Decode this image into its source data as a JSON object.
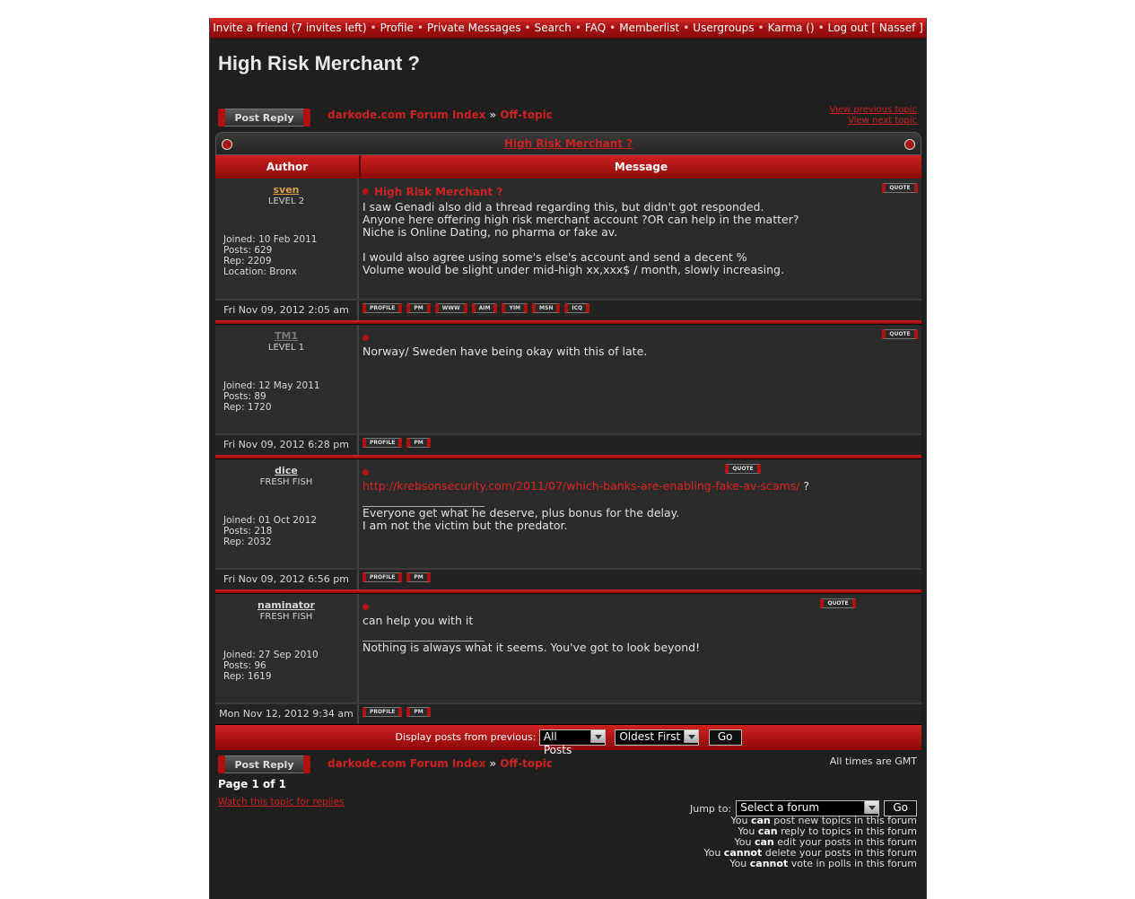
{
  "nav": {
    "items": [
      "Invite a friend (7 invites left)",
      "Profile",
      "Private Messages",
      "Search",
      "FAQ",
      "Memberlist",
      "Usergroups",
      "Karma ()",
      "Log out [ Nassef ]"
    ]
  },
  "page_title": "High Risk Merchant ?",
  "post_reply_label": "Post Reply",
  "breadcrumb": {
    "forum_index": "darkode.com Forum Index",
    "separator": "»",
    "forum": "Off-topic"
  },
  "topic_nav": {
    "previous": "View previous topic",
    "next": "View next topic"
  },
  "table": {
    "title": "High Risk Merchant ?",
    "col_author": "Author",
    "col_message": "Message"
  },
  "posts": [
    {
      "author": "sven",
      "author_color": "#d8a04a",
      "rank": "LEVEL 2",
      "info": [
        "Joined: 10 Feb 2011",
        "Posts: 629",
        "Rep: 2209",
        "Location: Bronx"
      ],
      "subject": "High Risk Merchant ?",
      "body": "I saw Genadi also did a thread regarding this, but didn't got responded.\nAnyone here offering high risk merchant account ?OR can help in the matter?\nNiche is Online Dating, no pharma or fake av.\n\nI would also agree using some's else's account and send a decent %\nVolume would be slight under mid-high xx,xxx$ / month, slowly increasing.",
      "date": "Fri Nov 09, 2012 2:05 am",
      "buttons": [
        "PROFILE",
        "PM",
        "WWW",
        "AIM",
        "YIM",
        "MSN",
        "ICQ"
      ],
      "quote": "QUOTE"
    },
    {
      "author": "TM1",
      "author_color": "#777777",
      "rank": "LEVEL 1",
      "info": [
        "Joined: 12 May 2011",
        "Posts: 89",
        "Rep: 1720"
      ],
      "subject": "",
      "body": "Norway/ Sweden have being okay with this of late.",
      "date": "Fri Nov 09, 2012 6:28 pm",
      "buttons": [
        "PROFILE",
        "PM"
      ],
      "quote": "QUOTE"
    },
    {
      "author": "dice",
      "author_color": "#d8d8d8",
      "rank": "FRESH FISH",
      "info": [
        "Joined: 01 Oct 2012",
        "Posts: 218",
        "Rep: 2032"
      ],
      "subject": "",
      "link": "http://krebsonsecurity.com/2011/07/which-banks-are-enabling-fake-av-scams/",
      "link_suffix": " ?",
      "signature": "Everyone get what he deserve, plus bonus for the delay.\nI am not the victim but the predator.",
      "date": "Fri Nov 09, 2012 6:56 pm",
      "buttons": [
        "PROFILE",
        "PM"
      ],
      "quote": "QUOTE"
    },
    {
      "author": "naminator",
      "author_color": "#d8d8d8",
      "rank": "FRESH FISH",
      "info": [
        "Joined: 27 Sep 2010",
        "Posts: 96",
        "Rep: 1619"
      ],
      "subject": "",
      "body": "can help you with it",
      "signature": "Nothing is always what it seems. You've got to look beyond!",
      "date": "Mon Nov 12, 2012 9:34 am",
      "buttons": [
        "PROFILE",
        "PM"
      ],
      "quote": "QUOTE"
    }
  ],
  "display": {
    "label": "Display posts from previous:",
    "posts_select": "All Posts",
    "order_select": "Oldest First",
    "go": "Go"
  },
  "timezone": "All times are GMT",
  "page_info": "Page 1 of 1",
  "watch_topic": "Watch this topic for replies",
  "jump": {
    "label": "Jump to:",
    "select": "Select a forum",
    "go": "Go"
  },
  "permissions": [
    [
      "You ",
      "can",
      " post new topics in this forum"
    ],
    [
      "You ",
      "can",
      " reply to topics in this forum"
    ],
    [
      "You ",
      "can",
      " edit your posts in this forum"
    ],
    [
      "You ",
      "cannot",
      " delete your posts in this forum"
    ],
    [
      "You ",
      "cannot",
      " vote in polls in this forum"
    ]
  ]
}
